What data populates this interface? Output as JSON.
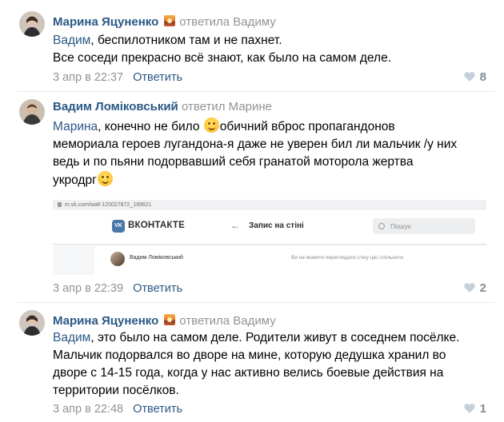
{
  "comments": [
    {
      "author": "Марина Яцуненко",
      "replied": "ответила Вадиму",
      "mention": "Вадим",
      "lines": [
        ", беспилотником там и не пахнет.",
        "Все соседи прекрасно всё знают, как было на самом деле."
      ],
      "date": "3 апр в 22:37",
      "reply_label": "Ответить",
      "likes": "8"
    },
    {
      "author": "Вадим Ломіковський",
      "replied": "ответил Марине",
      "mention": "Марина",
      "line1_before": ", конечно не било ",
      "line1_after": "обичний вброс пропагандонов",
      "line2": "мемориала героев лугандона-я даже не уверен бил ли мальчик /у них",
      "line3": "ведь и по пьяни подорвавший себя гранатой моторола жертва",
      "line4": "укродрг",
      "date": "3 апр в 22:39",
      "reply_label": "Ответить",
      "likes": "2",
      "screenshot": {
        "url": "m.vk.com/wall-120027872_199621",
        "brand": "ВКОНТАКТЕ",
        "logo": "VK",
        "title": "Запис на стіні",
        "search_placeholder": "Пошук",
        "user": "Вадим Ломіковський",
        "note": "Ви не можете переглядати стіну цієї спільноти."
      }
    },
    {
      "author": "Марина Яцуненко",
      "replied": "ответила Вадиму",
      "mention": "Вадим",
      "lines": [
        ", это было на самом деле. Родители живут в соседнем посёлке.",
        "Мальчик подорвался во дворе на мине, которую дедушка хранил во",
        "дворе с 14-15 года, когда у нас активно велись боевые действия на",
        "территории посёлков."
      ],
      "date": "3 апр в 22:48",
      "reply_label": "Ответить",
      "likes": "1"
    }
  ],
  "colors": {
    "link": "#2a5885",
    "muted": "#939393",
    "like": "#828a99",
    "divider": "#e7e8ec"
  }
}
